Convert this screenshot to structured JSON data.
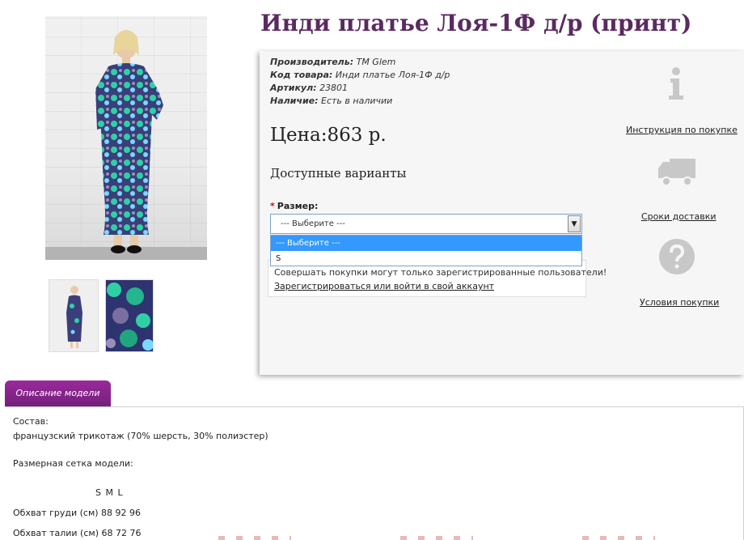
{
  "product": {
    "title": "Инди платье Лоя-1Ф д/р (принт)",
    "meta": {
      "manufacturer_label": "Производитель:",
      "manufacturer_value": "ТМ Glem",
      "code_label": "Код товара:",
      "code_value": "Инди платье Лоя-1Ф д/р",
      "sku_label": "Артикул:",
      "sku_value": "23801",
      "stock_label": "Наличие:",
      "stock_value": "Есть в наличии"
    },
    "price": "Цена:863 р.",
    "variants_heading": "Доступные варианты",
    "size_required_mark": "*",
    "size_label": "Размер:",
    "size_select_value": "--- Выберите ---",
    "size_options": [
      "--- Выберите ---",
      "S"
    ],
    "notice_text": "Совершать покупки могут только зарегистрированные пользователи!",
    "notice_link": "Зарегистрироваться или войти в свой аккаунт"
  },
  "side_links": {
    "instruction": "Инструкция по покупке",
    "delivery": "Сроки доставки",
    "terms": "Условия покупки"
  },
  "tabs": {
    "description": "Описание модели"
  },
  "description": {
    "composition_label": "Состав:",
    "composition_value": "французский трикотаж (70% шерсть, 30% полиэстер)",
    "size_chart_label": "Размерная сетка модели:",
    "sizes_header": "S  M  L",
    "bust": "Обхват груди (см) 88 92 96",
    "waist": "Обхват талии (см) 68 72 76"
  },
  "colors": {
    "title": "#5a2a61",
    "tab": "#741f7c",
    "select_highlight": "#3399ff"
  }
}
